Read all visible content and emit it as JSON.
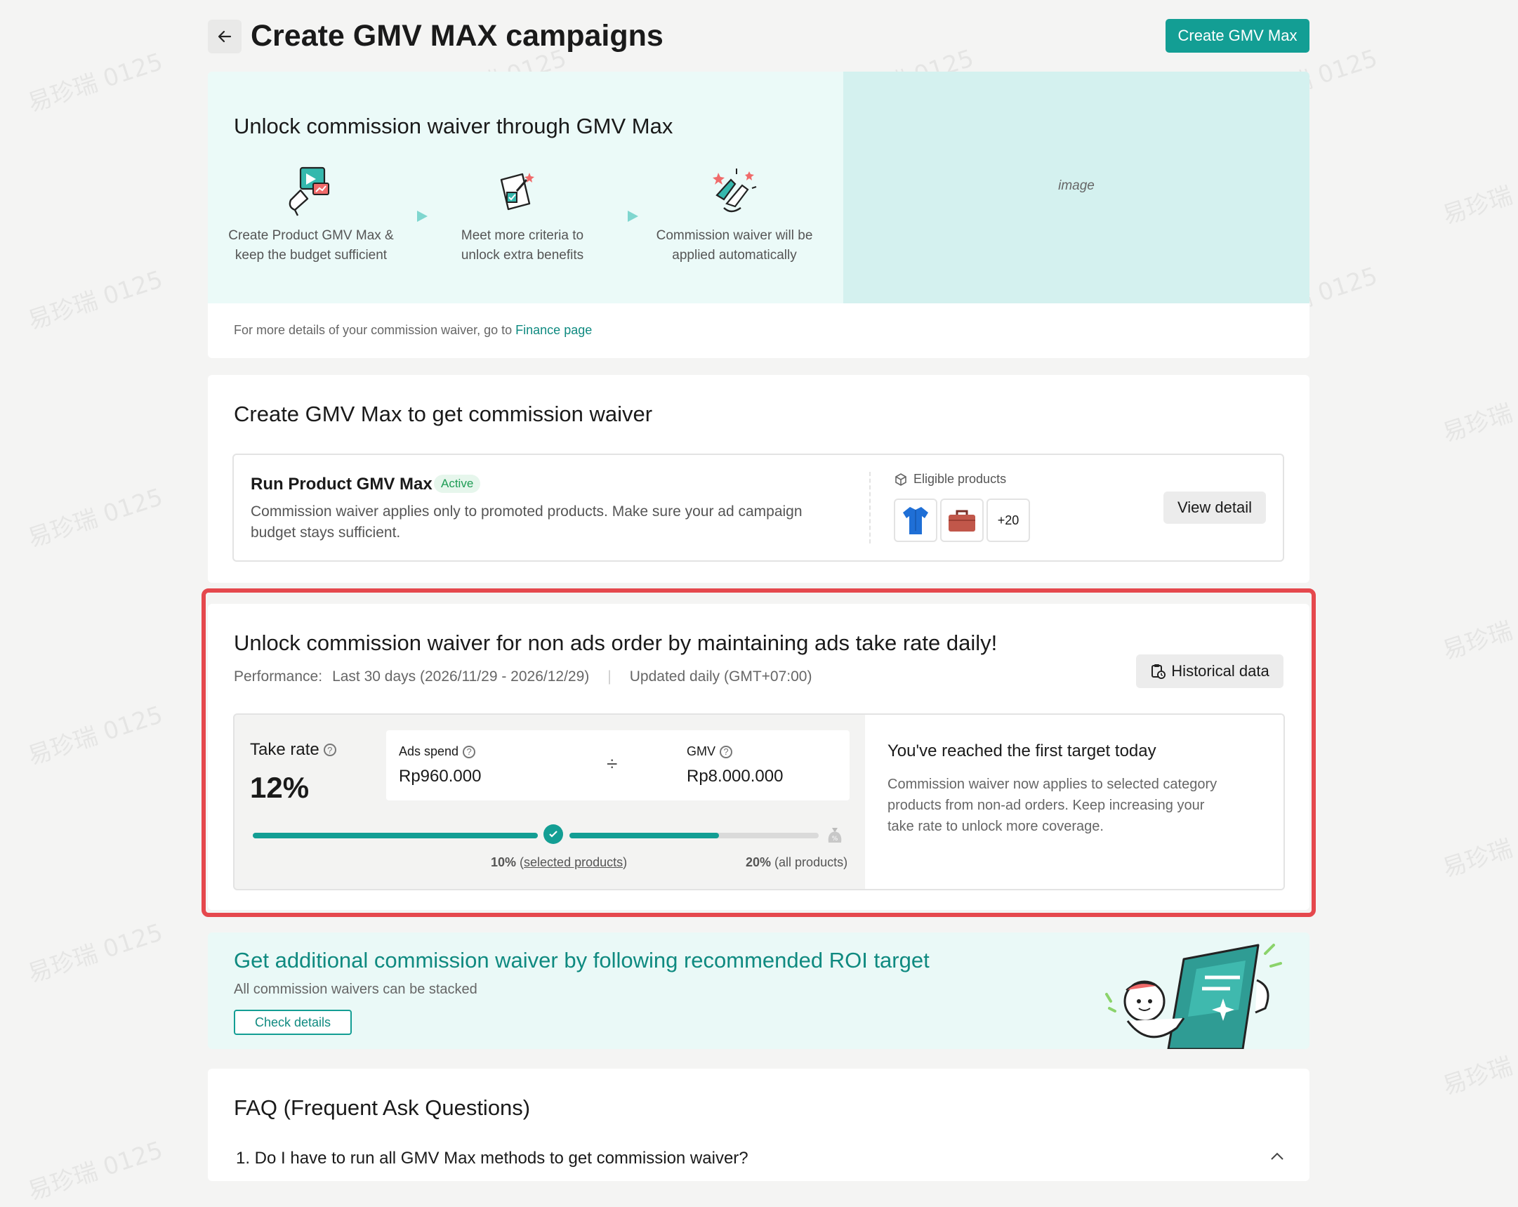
{
  "header": {
    "title": "Create GMV MAX campaigns",
    "primary_button": "Create GMV Max"
  },
  "hero": {
    "title": "Unlock commission waiver through GMV Max",
    "steps": [
      {
        "line1": "Create Product GMV Max &",
        "line2": "keep the budget sufficient",
        "icon": "megaphone-icon"
      },
      {
        "line1": "Meet more criteria to",
        "line2": "unlock extra benefits",
        "icon": "checklist-icon"
      },
      {
        "line1": "Commission waiver will be",
        "line2": "applied automatically",
        "icon": "celebrate-hands-icon"
      }
    ],
    "image_placeholder": "image",
    "footer_text": "For more details of your commission waiver, go to ",
    "footer_link": "Finance page"
  },
  "create_section": {
    "title": "Create GMV Max to get commission waiver",
    "campaign": {
      "name": "Run Product GMV Max",
      "status": "Active",
      "description_line1": "Commission waiver applies only to promoted products. Make sure your ad campaign",
      "description_line2": "budget stays sufficient.",
      "eligible_label": "Eligible products",
      "more_count": "+20",
      "view_button": "View detail"
    }
  },
  "take_rate_section": {
    "title": "Unlock commission waiver for non ads order by maintaining ads take rate daily!",
    "performance_label": "Performance:",
    "performance_range": "Last 30 days (2026/11/29 - 2026/12/29)",
    "updated_text": "Updated daily (GMT+07:00)",
    "history_button": "Historical data",
    "take_rate_label": "Take rate",
    "take_rate_value": "12%",
    "ads_spend_label": "Ads spend",
    "ads_spend_value": "Rp960.000",
    "divide_symbol": "÷",
    "gmv_label": "GMV",
    "gmv_value": "Rp8.000.000",
    "milestone1_pct": "10%",
    "milestone1_desc": "selected products",
    "milestone2_pct": "20%",
    "milestone2_desc": "(all products)",
    "progress_fraction": 0.6,
    "target_title": "You've reached the first target today",
    "target_line1": "Commission waiver now applies to selected category",
    "target_line2": "products from non-ad orders. Keep increasing your",
    "target_line3": "take rate to unlock more coverage."
  },
  "roi_banner": {
    "title": "Get additional commission waiver by following recommended ROI target",
    "subtitle": "All commission waivers can be stacked",
    "button": "Check details"
  },
  "faq": {
    "title": "FAQ (Frequent Ask Questions)",
    "q1": "1. Do I have to run all GMV Max methods to get commission waiver?"
  },
  "watermark": "易珍瑞 0125",
  "colors": {
    "brand": "#139e94",
    "highlight_border": "#e5484d",
    "active_green": "#1e9c55"
  }
}
